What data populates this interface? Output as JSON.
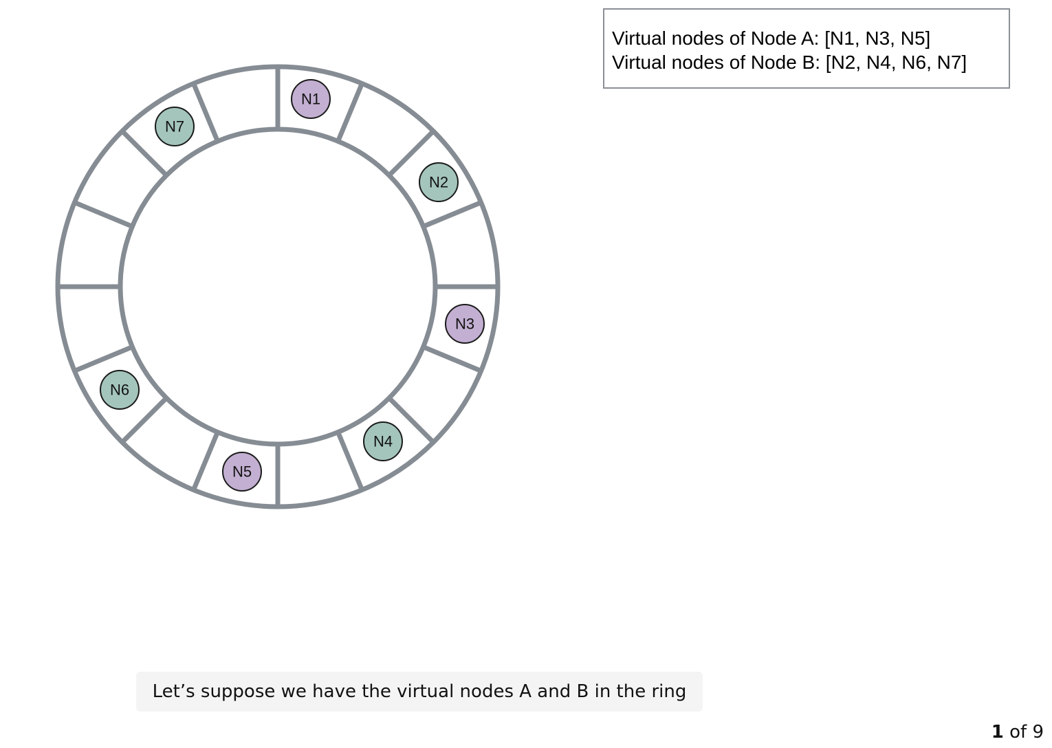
{
  "ring": {
    "segment_count": 16,
    "ring_color": "#868c93",
    "virtual_nodes": [
      {
        "label": "N1",
        "owner": "A",
        "color": "#c2afd1"
      },
      {
        "label": "N2",
        "owner": "B",
        "color": "#a4c5bc"
      },
      {
        "label": "N3",
        "owner": "A",
        "color": "#c2afd1"
      },
      {
        "label": "N4",
        "owner": "B",
        "color": "#a4c5bc"
      },
      {
        "label": "N5",
        "owner": "A",
        "color": "#c2afd1"
      },
      {
        "label": "N6",
        "owner": "B",
        "color": "#a4c5bc"
      },
      {
        "label": "N7",
        "owner": "B",
        "color": "#a4c5bc"
      }
    ]
  },
  "legend": {
    "line_a": "Virtual nodes of Node A: [N1, N3, N5]",
    "line_b": "Virtual nodes of Node B: [N2, N4, N6, N7]"
  },
  "caption": "Let’s suppose we have the virtual nodes A and B in the ring",
  "pager": {
    "current": "1",
    "rest": " of 9"
  }
}
